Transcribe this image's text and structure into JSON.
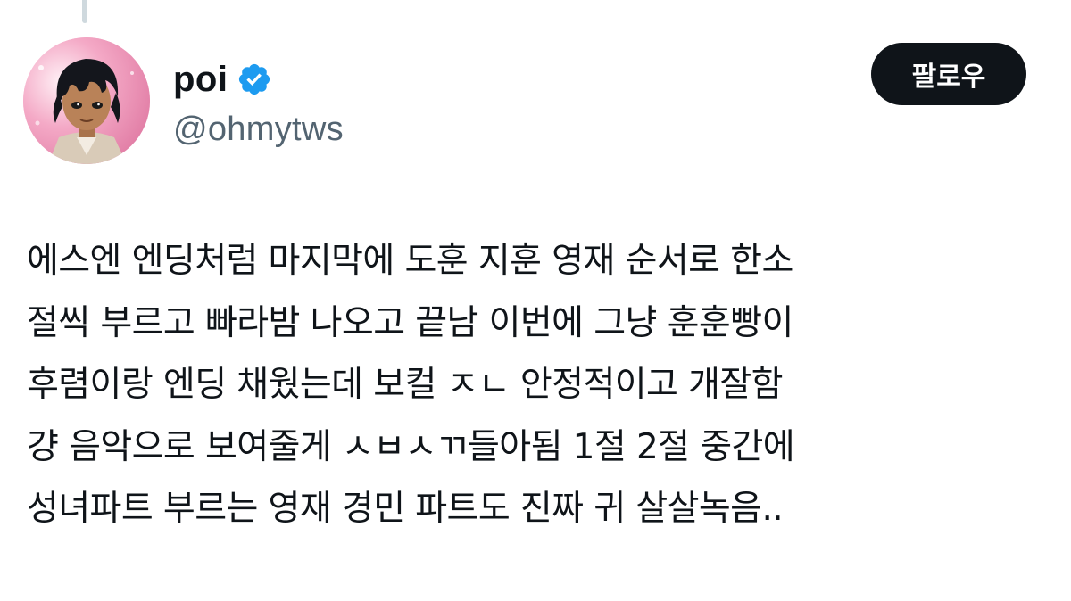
{
  "tweet": {
    "display_name": "poi",
    "handle": "@ohmytws",
    "verified": true,
    "verified_badge_color": "#1d9bf0",
    "follow_label": "팔로우",
    "text_lines": [
      "에스엔 엔딩처럼 마지막에 도훈 지훈 영재 순서로 한소",
      "절씩 부르고 빠라밤 나오고 끝남 이번에 그냥 훈훈빵이",
      "후렴이랑 엔딩 채웠는데 보컬 ㅈㄴ 안정적이고 개잘함",
      "걍 음악으로 보여줄게 ㅅㅂㅅㄲ들아됨 1절 2절 중간에",
      "성녀파트 부르는 영재 경민 파트도 진짜 귀 살살녹음.."
    ]
  },
  "icons": {
    "verified": "verified-badge-icon",
    "avatar": "profile-avatar"
  },
  "colors": {
    "text_primary": "#0f1419",
    "text_secondary": "#536471",
    "button_bg": "#0f1419",
    "button_text": "#ffffff"
  }
}
